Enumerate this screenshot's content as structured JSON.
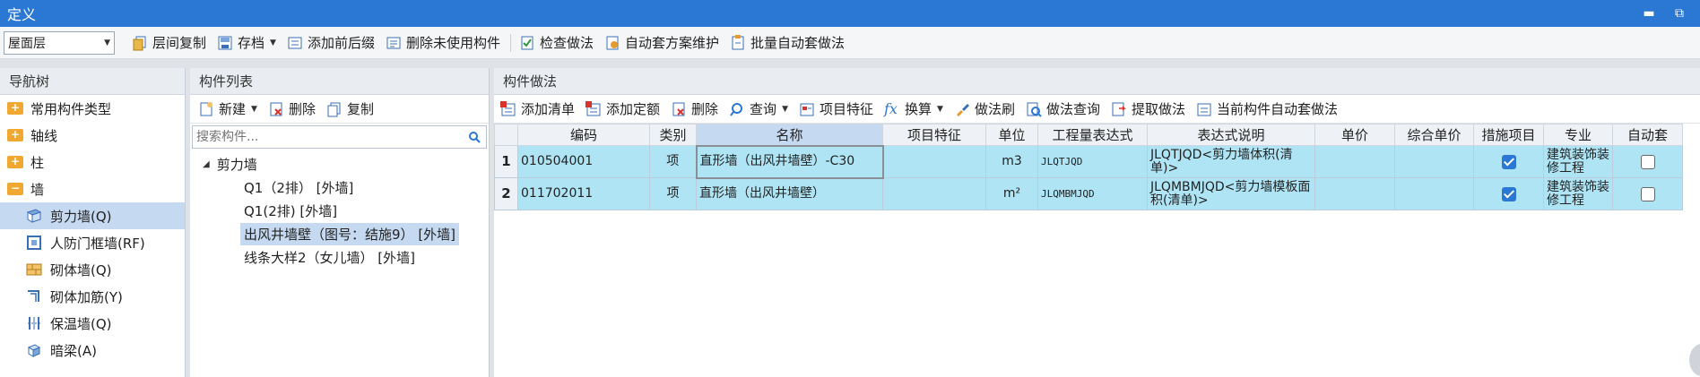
{
  "window": {
    "title": "定义",
    "minimize_label": "▬",
    "restore_label": "⧉"
  },
  "toolbar": {
    "floor_value": "屋面层",
    "buttons": [
      {
        "label": "层间复制",
        "icon": "copy-layers-icon"
      },
      {
        "label": "存档",
        "icon": "archive-icon",
        "dropdown": true
      },
      {
        "label": "添加前后缀",
        "icon": "add-prefix-icon"
      },
      {
        "label": "删除未使用构件",
        "icon": "delete-unused-icon"
      },
      {
        "label": "检查做法",
        "icon": "check-method-icon"
      },
      {
        "label": "自动套方案维护",
        "icon": "auto-scheme-icon"
      },
      {
        "label": "批量自动套做法",
        "icon": "batch-auto-icon"
      }
    ]
  },
  "nav": {
    "title": "导航树",
    "items": [
      {
        "label": "常用构件类型",
        "type": "folder"
      },
      {
        "label": "轴线",
        "type": "folder"
      },
      {
        "label": "柱",
        "type": "folder"
      },
      {
        "label": "墙",
        "type": "folder-open"
      },
      {
        "label": "剪力墙(Q)",
        "type": "child",
        "selected": true,
        "icon": "shear-wall-icon"
      },
      {
        "label": "人防门框墙(RF)",
        "type": "child",
        "icon": "civil-defense-wall-icon"
      },
      {
        "label": "砌体墙(Q)",
        "type": "child",
        "icon": "masonry-wall-icon"
      },
      {
        "label": "砌体加筋(Y)",
        "type": "child",
        "icon": "masonry-rebar-icon"
      },
      {
        "label": "保温墙(Q)",
        "type": "child",
        "icon": "insulation-wall-icon"
      },
      {
        "label": "暗梁(A)",
        "type": "child",
        "icon": "hidden-beam-icon"
      }
    ]
  },
  "components": {
    "title": "构件列表",
    "new_label": "新建",
    "delete_label": "删除",
    "copy_label": "复制",
    "search_placeholder": "搜索构件...",
    "tree_root": "剪力墙",
    "items": [
      {
        "label": "Q1（2排） [外墙]",
        "selected": false
      },
      {
        "label": "Q1(2排) [外墙]",
        "selected": false
      },
      {
        "label": "出风井墙壁（图号：结施9） [外墙]",
        "selected": true
      },
      {
        "label": "线条大样2（女儿墙） [外墙]",
        "selected": false
      }
    ]
  },
  "method": {
    "title": "构件做法",
    "toolbar": [
      {
        "label": "添加清单",
        "icon": "add-list-icon"
      },
      {
        "label": "添加定额",
        "icon": "add-quota-icon"
      },
      {
        "label": "删除",
        "icon": "delete-icon"
      },
      {
        "label": "查询",
        "icon": "query-icon",
        "dropdown": true
      },
      {
        "label": "项目特征",
        "icon": "item-feature-icon"
      },
      {
        "label": "换算",
        "icon": "fx-icon",
        "dropdown": true
      },
      {
        "label": "做法刷",
        "icon": "method-brush-icon"
      },
      {
        "label": "做法查询",
        "icon": "method-query-icon"
      },
      {
        "label": "提取做法",
        "icon": "extract-method-icon"
      },
      {
        "label": "当前构件自动套做法",
        "icon": "current-auto-icon"
      }
    ],
    "columns": [
      "",
      "编码",
      "类别",
      "名称",
      "项目特征",
      "单位",
      "工程量表达式",
      "表达式说明",
      "单价",
      "综合单价",
      "措施项目",
      "专业",
      "自动套"
    ],
    "rows": [
      {
        "no": "1",
        "code": "010504001",
        "category": "项",
        "name": "直形墙（出风井墙壁）-C30",
        "feature": "",
        "unit": "m3",
        "expr": "JLQTJQD",
        "expr_desc": "JLQTJQD<剪力墙体积(清单)>",
        "price": "",
        "total_price": "",
        "measure": true,
        "specialty": "建筑装饰装修工程",
        "auto": false
      },
      {
        "no": "2",
        "code": "011702011",
        "category": "项",
        "name": "直形墙（出风井墙壁）",
        "feature": "",
        "unit": "m²",
        "expr": "JLQMBMJQD",
        "expr_desc": "JLQMBMJQD<剪力墙模板面积(清单)>",
        "price": "",
        "total_price": "",
        "measure": true,
        "specialty": "建筑装饰装修工程",
        "auto": false
      }
    ]
  }
}
